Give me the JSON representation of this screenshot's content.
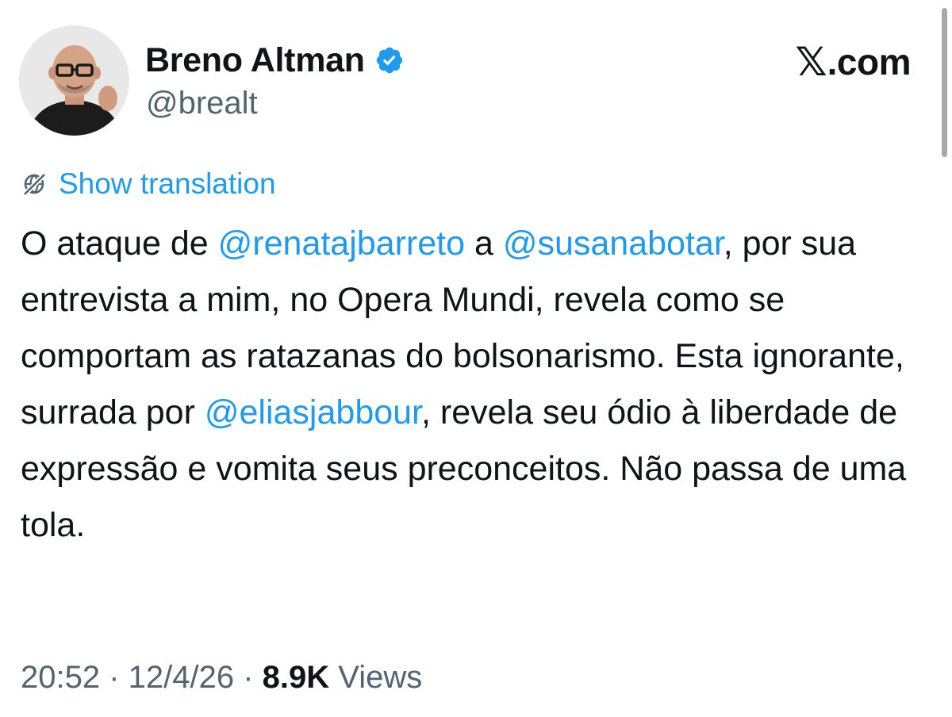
{
  "author": {
    "display_name": "Breno Altman",
    "handle": "@brealt",
    "verified": true,
    "avatar_icon": "profile-photo"
  },
  "brand": {
    "logo": "𝕏",
    "text": ".com"
  },
  "translation": {
    "icon": "globe-slash-icon",
    "label": "Show translation"
  },
  "tweet": {
    "segments": [
      {
        "text": "O ataque de ",
        "type": "text"
      },
      {
        "text": "@renatajbarreto",
        "type": "mention"
      },
      {
        "text": " a ",
        "type": "text"
      },
      {
        "text": "@susanabotar",
        "type": "mention"
      },
      {
        "text": ", por sua entrevista a mim, no Opera Mundi, revela como se comportam as ratazanas do bolsonarismo. Esta ignorante, surrada por ",
        "type": "text"
      },
      {
        "text": "@eliasjabbour",
        "type": "mention"
      },
      {
        "text": ", revela seu ódio à liberdade de expressão e vomita seus preconceitos. Não passa de uma tola.",
        "type": "text"
      }
    ]
  },
  "meta": {
    "time": "20:52",
    "separator": " · ",
    "date": "12/4/26",
    "views_count": "8.9K",
    "views_label": "Views"
  },
  "colors": {
    "accent": "#1d9bf0",
    "text": "#0f1419",
    "secondary": "#536471"
  }
}
